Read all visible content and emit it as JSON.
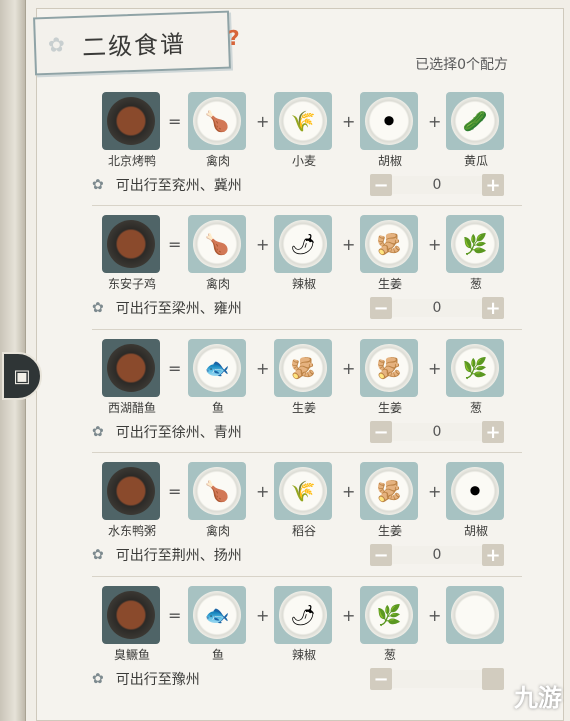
{
  "title": "二级食谱",
  "selected_info": "已选择0个配方",
  "recipes": [
    {
      "dish": "北京烤鸭",
      "ingredients": [
        "禽肉",
        "小麦",
        "胡椒",
        "黄瓜"
      ],
      "route": "可出行至兖州、冀州",
      "count": "0",
      "minus": "−",
      "plus": "+"
    },
    {
      "dish": "东安子鸡",
      "ingredients": [
        "禽肉",
        "辣椒",
        "生姜",
        "葱"
      ],
      "route": "可出行至梁州、雍州",
      "count": "0",
      "minus": "−",
      "plus": "+"
    },
    {
      "dish": "西湖醋鱼",
      "ingredients": [
        "鱼",
        "生姜",
        "生姜",
        "葱"
      ],
      "route": "可出行至徐州、青州",
      "count": "0",
      "minus": "−",
      "plus": "+"
    },
    {
      "dish": "水东鸭粥",
      "ingredients": [
        "禽肉",
        "稻谷",
        "生姜",
        "胡椒"
      ],
      "route": "可出行至荆州、扬州",
      "count": "0",
      "minus": "−",
      "plus": "+"
    },
    {
      "dish": "臭鳜鱼",
      "ingredients": [
        "鱼",
        "辣椒",
        "葱",
        ""
      ],
      "route": "可出行至豫州",
      "count": "",
      "minus": "−",
      "plus": ""
    }
  ],
  "symbols": {
    "equals": "=",
    "plus": "+"
  },
  "icons": {
    "dishes": [
      "roast-duck-icon",
      "chicken-dish-icon",
      "vinegar-fish-icon",
      "duck-porridge-icon",
      "stinky-mandarin-fish-icon"
    ],
    "ingredients": {
      "禽肉": "poultry-icon",
      "小麦": "wheat-icon",
      "胡椒": "pepper-icon",
      "黄瓜": "cucumber-icon",
      "辣椒": "chili-icon",
      "生姜": "ginger-icon",
      "葱": "scallion-icon",
      "鱼": "fish-icon",
      "稻谷": "rice-grain-icon"
    }
  },
  "watermark": "九游"
}
